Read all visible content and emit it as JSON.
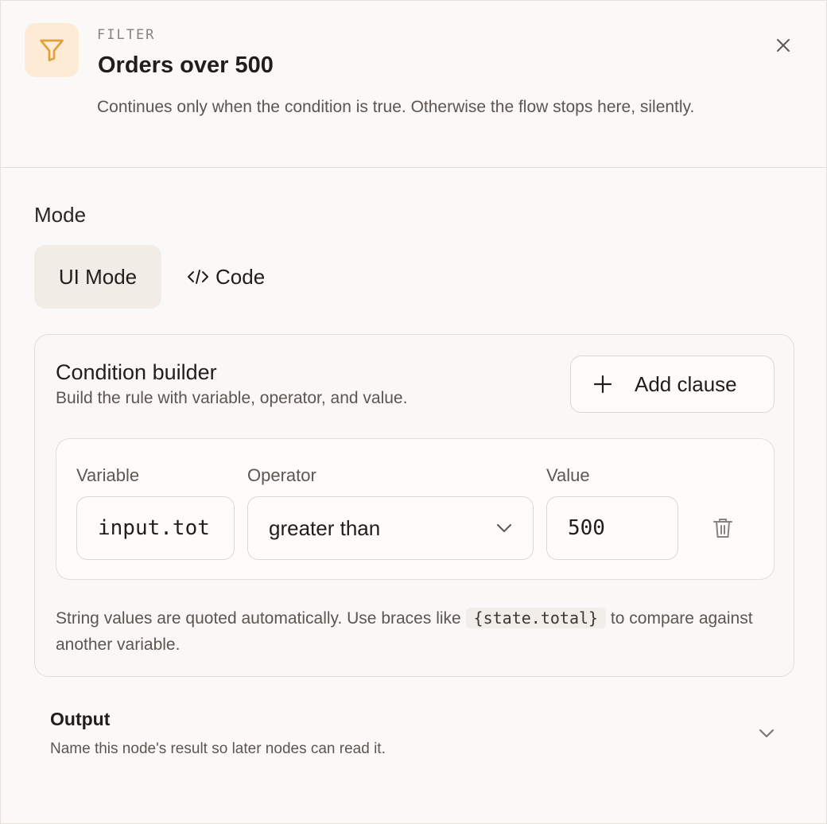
{
  "header": {
    "eyebrow": "FILTER",
    "title": "Orders over 500",
    "description": "Continues only when the condition is true. Otherwise the flow stops here, silently.",
    "icon": "filter-icon",
    "accent_color": "#e0a13a"
  },
  "mode": {
    "label": "Mode",
    "tabs": [
      {
        "label": "UI Mode",
        "selected": true
      },
      {
        "label": "Code",
        "icon": "code-icon",
        "selected": false
      }
    ]
  },
  "builder": {
    "title": "Condition builder",
    "subtitle": "Build the rule with variable, operator, and value.",
    "add_label": "Add clause",
    "clause": {
      "variable_label": "Variable",
      "variable_value": "input.tot",
      "operator_label": "Operator",
      "operator_value": "greater than",
      "value_label": "Value",
      "value_value": "500"
    },
    "hint_before": "String values are quoted automatically. Use braces like ",
    "hint_code": "{state.total}",
    "hint_after": " to compare against another variable."
  },
  "output": {
    "title": "Output",
    "subtitle": "Name this node's result so later nodes can read it."
  }
}
